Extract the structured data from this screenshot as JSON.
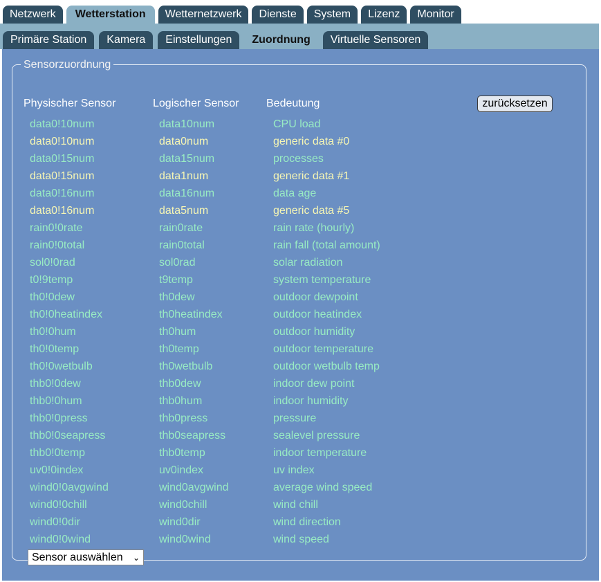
{
  "nav": {
    "main_tabs": [
      {
        "label": "Netzwerk",
        "active": false
      },
      {
        "label": "Wetterstation",
        "active": true
      },
      {
        "label": "Wetternetzwerk",
        "active": false
      },
      {
        "label": "Dienste",
        "active": false
      },
      {
        "label": "System",
        "active": false
      },
      {
        "label": "Lizenz",
        "active": false
      },
      {
        "label": "Monitor",
        "active": false
      }
    ],
    "sub_tabs": [
      {
        "label": "Primäre Station",
        "active": false
      },
      {
        "label": "Kamera",
        "active": false
      },
      {
        "label": "Einstellungen",
        "active": false
      },
      {
        "label": "Zuordnung",
        "active": true
      },
      {
        "label": "Virtuelle Sensoren",
        "active": false
      }
    ]
  },
  "mapping": {
    "legend": "Sensorzuordnung",
    "headers": {
      "physical": "Physischer Sensor",
      "logical": "Logischer Sensor",
      "meaning": "Bedeutung"
    },
    "reset_label": "zurücksetzen",
    "select_label": "Sensor auswählen",
    "colors": {
      "unassigned_text": "#98ebc3",
      "assigned_text": "#f6f6b4",
      "panel_bg": "#6b8fc3"
    },
    "rows": [
      {
        "physical": "data0!10num",
        "logical": "data10num",
        "meaning": "CPU load",
        "assigned": false
      },
      {
        "physical": "data0!10num",
        "logical": "data0num",
        "meaning": "generic data #0",
        "assigned": true
      },
      {
        "physical": "data0!15num",
        "logical": "data15num",
        "meaning": "processes",
        "assigned": false
      },
      {
        "physical": "data0!15num",
        "logical": "data1num",
        "meaning": "generic data #1",
        "assigned": true
      },
      {
        "physical": "data0!16num",
        "logical": "data16num",
        "meaning": "data age",
        "assigned": false
      },
      {
        "physical": "data0!16num",
        "logical": "data5num",
        "meaning": "generic data #5",
        "assigned": true
      },
      {
        "physical": "rain0!0rate",
        "logical": "rain0rate",
        "meaning": "rain rate (hourly)",
        "assigned": false
      },
      {
        "physical": "rain0!0total",
        "logical": "rain0total",
        "meaning": "rain fall (total amount)",
        "assigned": false
      },
      {
        "physical": "sol0!0rad",
        "logical": "sol0rad",
        "meaning": "solar radiation",
        "assigned": false
      },
      {
        "physical": "t0!9temp",
        "logical": "t9temp",
        "meaning": "system temperature",
        "assigned": false
      },
      {
        "physical": "th0!0dew",
        "logical": "th0dew",
        "meaning": "outdoor dewpoint",
        "assigned": false
      },
      {
        "physical": "th0!0heatindex",
        "logical": "th0heatindex",
        "meaning": "outdoor heatindex",
        "assigned": false
      },
      {
        "physical": "th0!0hum",
        "logical": "th0hum",
        "meaning": "outdoor humidity",
        "assigned": false
      },
      {
        "physical": "th0!0temp",
        "logical": "th0temp",
        "meaning": "outdoor temperature",
        "assigned": false
      },
      {
        "physical": "th0!0wetbulb",
        "logical": "th0wetbulb",
        "meaning": "outdoor wetbulb temp",
        "assigned": false
      },
      {
        "physical": "thb0!0dew",
        "logical": "thb0dew",
        "meaning": "indoor dew point",
        "assigned": false
      },
      {
        "physical": "thb0!0hum",
        "logical": "thb0hum",
        "meaning": "indoor humidity",
        "assigned": false
      },
      {
        "physical": "thb0!0press",
        "logical": "thb0press",
        "meaning": "pressure",
        "assigned": false
      },
      {
        "physical": "thb0!0seapress",
        "logical": "thb0seapress",
        "meaning": "sealevel pressure",
        "assigned": false
      },
      {
        "physical": "thb0!0temp",
        "logical": "thb0temp",
        "meaning": "indoor temperature",
        "assigned": false
      },
      {
        "physical": "uv0!0index",
        "logical": "uv0index",
        "meaning": "uv index",
        "assigned": false
      },
      {
        "physical": "wind0!0avgwind",
        "logical": "wind0avgwind",
        "meaning": "average wind speed",
        "assigned": false
      },
      {
        "physical": "wind0!0chill",
        "logical": "wind0chill",
        "meaning": "wind chill",
        "assigned": false
      },
      {
        "physical": "wind0!0dir",
        "logical": "wind0dir",
        "meaning": "wind direction",
        "assigned": false
      },
      {
        "physical": "wind0!0wind",
        "logical": "wind0wind",
        "meaning": "wind speed",
        "assigned": false
      }
    ]
  }
}
